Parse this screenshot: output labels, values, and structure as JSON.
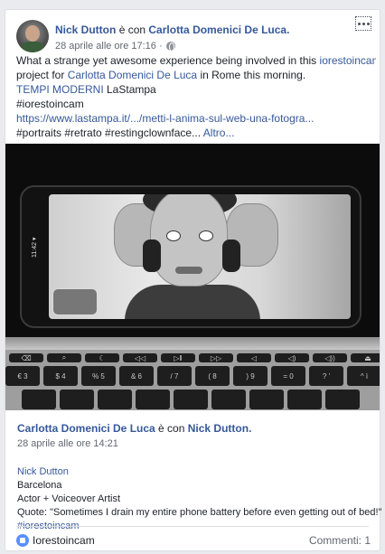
{
  "post": {
    "author": "Nick Dutton",
    "with_word": "è con",
    "tagged": "Carlotta Domenici De Luca.",
    "date": "28 aprile alle ore 17:16 ·",
    "text": {
      "line1_pre": "What a strange yet awesome experience being involved in this ",
      "line1_link": "iorestoincam",
      "line2_pre": "project for ",
      "line2_link": "Carlotta Domenici De Luca",
      "line2_post": " in Rome this morning.",
      "line3_link": "TEMPI MODERNI",
      "line3_post": " LaStampa",
      "line4": "#iorestoincam",
      "line5_link": "https://www.lastampa.it/.../metti-l-anima-sul-web-una-fotogra...",
      "line6_pre": "#portraits #retrato #restingclownface... ",
      "line6_link": "Altro..."
    }
  },
  "photo": {
    "phone_time": "11:42 ▾",
    "keys_row1": [
      "⌫",
      "⌕",
      "☾",
      "◁◁",
      "▷‖",
      "▷▷",
      "◁",
      "◁)",
      "◁))",
      "⏏"
    ],
    "keys_row2": [
      "€ 3",
      "$ 4",
      "% 5",
      "& 6",
      "/ 7",
      "( 8",
      ") 9",
      "= 0",
      "? '",
      "^ ì"
    ]
  },
  "shared": {
    "author": "Carlotta Domenici De Luca",
    "with_word": "è con",
    "tagged": "Nick Dutton.",
    "date": "28 aprile alle ore 14:21",
    "name": "Nick Dutton",
    "city": "Barcelona",
    "role": "Actor + Voiceover Artist",
    "quote": "Quote: \"Sometimes I drain my entire phone battery before even getting out of bed!\"",
    "hashtag": "#iorestoincam"
  },
  "footer": {
    "reaction_name": "Iorestoincam",
    "comments": "Commenti: 1"
  },
  "colors": {
    "link": "#365899",
    "meta": "#616770",
    "like": "#5890ff"
  }
}
